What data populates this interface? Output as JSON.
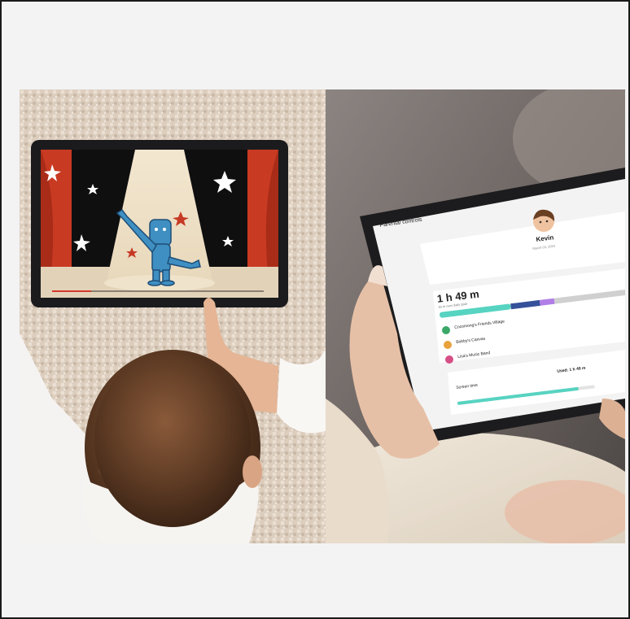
{
  "left_photo": {
    "scene": "child-using-tablet"
  },
  "right_photo": {
    "tablet_app": {
      "header": "Parental controls",
      "profile_name": "Kevin",
      "profile_subtext": "March 03, 2020",
      "screen_time_total": "1 h 49 m",
      "screen_time_note": "30 m over daily goal",
      "apps": [
        {
          "name": "Cocomong's Friends Village",
          "color": "#3aa867"
        },
        {
          "name": "Bobby's Canvas",
          "color": "#e9a23b"
        },
        {
          "name": "Lisa's Music Band",
          "color": "#d64f86"
        }
      ],
      "screen_time_label": "Screen time",
      "screen_time_used": "Used: 1 h 49 m",
      "usage_bar_colors": [
        "#57d3c1",
        "#35519a",
        "#b07ee6",
        "#d0d0d0"
      ]
    }
  }
}
